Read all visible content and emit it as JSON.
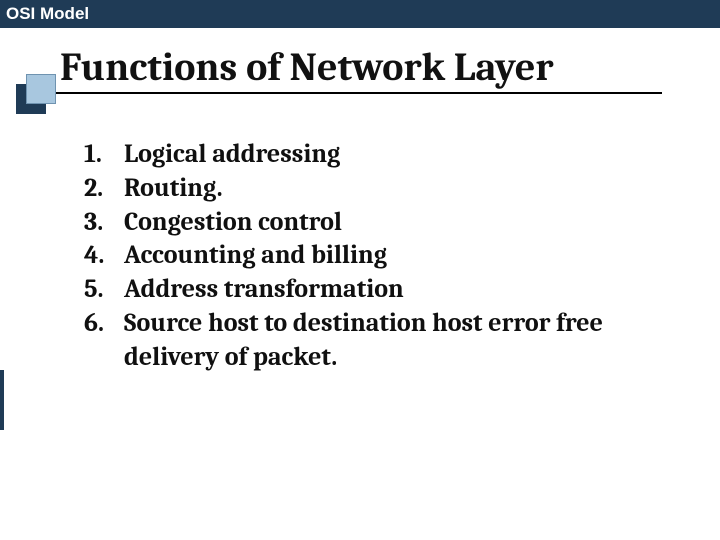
{
  "header": {
    "title": "OSI Model"
  },
  "slide": {
    "title": "Functions of Network Layer",
    "items": [
      {
        "num": "1.",
        "text": "Logical addressing"
      },
      {
        "num": "2.",
        "text": "Routing."
      },
      {
        "num": "3.",
        "text": "Congestion control"
      },
      {
        "num": "4.",
        "text": "Accounting and billing"
      },
      {
        "num": "5.",
        "text": "Address transformation"
      },
      {
        "num": "6.",
        "text": "Source host to destination host error free delivery of packet."
      }
    ]
  }
}
